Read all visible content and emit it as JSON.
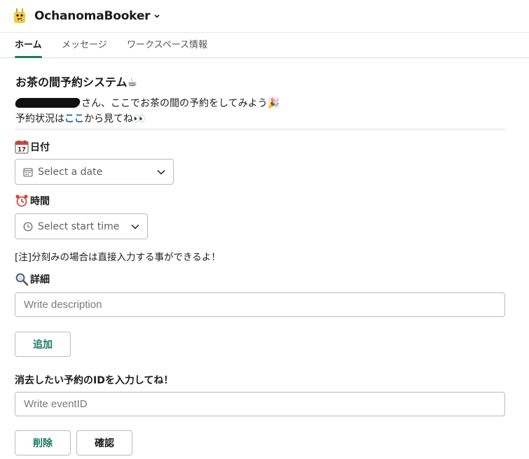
{
  "app": {
    "name": "OchanomaBooker"
  },
  "tabs": [
    {
      "label": "ホーム",
      "active": true
    },
    {
      "label": "メッセージ",
      "active": false
    },
    {
      "label": "ワークスペース情報",
      "active": false
    }
  ],
  "main": {
    "title": "お茶の間予約システム☕",
    "greeting_text": "さん、ここでお茶の間の予約をしてみよう🎉",
    "status_prefix": "予約状況は",
    "status_link": "ここ",
    "status_suffix": "から見てね👀"
  },
  "date_section": {
    "label": "日付",
    "icon": "calendar-icon",
    "placeholder": "Select a date"
  },
  "time_section": {
    "label": "時間",
    "icon": "alarm-clock-icon",
    "placeholder": "Select start time"
  },
  "note": "[注]分刻みの場合は直接入力する事ができるよ！",
  "detail_section": {
    "label": "詳細",
    "icon": "magnifier-icon",
    "placeholder": "Write description"
  },
  "add_button": "追加",
  "delete_section": {
    "label": "消去したい予約のIDを入力してね！",
    "placeholder": "Write eventID"
  },
  "delete_button": "削除",
  "confirm_button": "確認",
  "colors": {
    "accent_green": "#1a7a5e",
    "link_blue": "#1264a3"
  }
}
